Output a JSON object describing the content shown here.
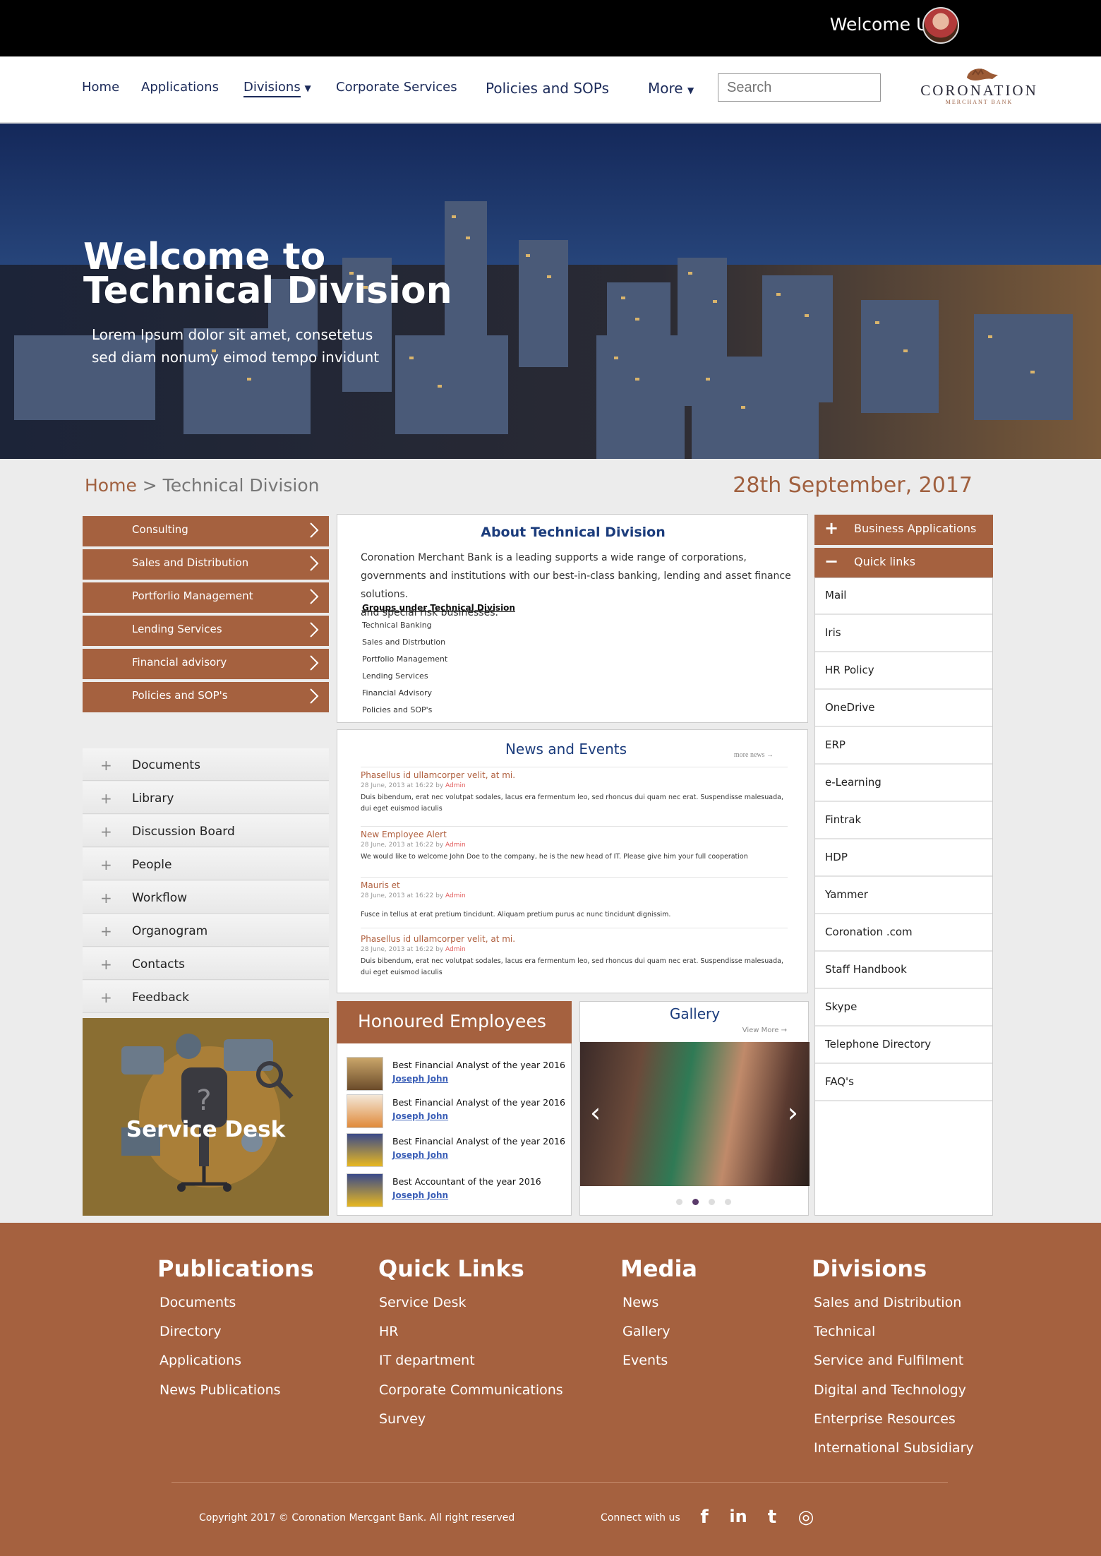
{
  "header": {
    "welcome": "Welcome User"
  },
  "nav": {
    "items": [
      "Home",
      "Applications",
      "Divisions",
      "Corporate Services",
      "Policies and SOPs",
      "More"
    ],
    "search_placeholder": "Search",
    "logo_name": "CORONATION",
    "logo_sub": "MERCHANT BANK"
  },
  "hero": {
    "title": "Welcome to Technical Division",
    "subtitle": "Lorem Ipsum dolor sit amet, consetetus sed diam nonumy eimod tempo invidunt"
  },
  "breadcrumb": {
    "home": "Home",
    "separator": " > ",
    "current": "Technical Division"
  },
  "date": "28th September, 2017",
  "left_menu": {
    "divisions": [
      "Consulting",
      "Sales and Distribution",
      "Portforlio Management",
      "Lending Services",
      "Financial advisory",
      "Policies and SOP's"
    ],
    "links": [
      "Documents",
      "Library",
      "Discussion Board",
      "People",
      "Workflow",
      "Organogram",
      "Contacts",
      "Feedback"
    ],
    "service_desk": "Service Desk"
  },
  "about": {
    "title": "About Technical Division",
    "body": "Coronation Merchant Bank is a leading supports a wide range of corporations, governments and institutions with our best-in-class banking, lending and asset finance solutions.",
    "body2": "and special risk businesses.",
    "groups_title": "Groups under Technical Division",
    "groups": [
      "Technical Banking",
      "Sales and Distrbution",
      "Portfolio Management",
      "Lending Services",
      "Financial Advisory",
      "Policies and SOP's"
    ]
  },
  "news": {
    "title": "News and Events",
    "more": "more news →",
    "items": [
      {
        "headline": "Phasellus id ullamcorper velit, at mi.",
        "date": "28 June, 2013 at 16:22 by ",
        "author": "Admin",
        "body": "Duis bibendum, erat nec volutpat sodales, lacus era fermentum leo, sed rhoncus dui quam nec erat. Suspendisse malesuada, dui eget euismod iaculis"
      },
      {
        "headline": "New Employee Alert",
        "date": "28 June, 2013 at 16:22 by ",
        "author": "Admin",
        "body": "We would like to welcome John Doe to the company, he is the new head of IT. Please give him your full cooperation"
      },
      {
        "headline": "Mauris et",
        "date": "28 June, 2013 at 16:22 by ",
        "author": "Admin",
        "body": "Fusce in tellus at erat pretium tincidunt. Aliquam pretium purus ac nunc tincidunt dignissim."
      },
      {
        "headline": "Phasellus id ullamcorper velit, at mi.",
        "date": "28 June, 2013 at 16:22 by ",
        "author": "Admin",
        "body": "Duis bibendum, erat nec volutpat sodales, lacus era fermentum leo, sed rhoncus dui quam nec erat. Suspendisse malesuada, dui eget euismod iaculis"
      }
    ]
  },
  "honoured": {
    "title": "Honoured Employees",
    "items": [
      {
        "award": "Best Financial Analyst of the year 2016",
        "name": "Joseph John"
      },
      {
        "award": "Best Financial Analyst of the year 2016",
        "name": "Joseph John"
      },
      {
        "award": "Best Financial Analyst of the year 2016",
        "name": "Joseph John"
      },
      {
        "award": "Best Accountant of the year 2016",
        "name": "Joseph John"
      }
    ]
  },
  "gallery": {
    "title": "Gallery",
    "view_more": "View More →",
    "active_slide": 2,
    "slide_count": 4
  },
  "right": {
    "business": "Business Applications",
    "quick": "Quick links",
    "links": [
      "Mail",
      "Iris",
      "HR Policy",
      "OneDrive",
      "ERP",
      "e-Learning",
      "Fintrak",
      "HDP",
      "Yammer",
      "Coronation .com",
      "Staff Handbook",
      "Skype",
      "Telephone Directory",
      "FAQ's"
    ]
  },
  "footer": {
    "publications": {
      "title": "Publications",
      "links": [
        "Documents",
        "Directory",
        "Applications",
        "News Publications"
      ]
    },
    "quick_links": {
      "title": "Quick Links",
      "links": [
        "Service Desk",
        "HR",
        "IT department",
        "Corporate Communications",
        "Survey"
      ]
    },
    "media": {
      "title": "Media",
      "links": [
        "News",
        "Gallery",
        "Events"
      ]
    },
    "divisions": {
      "title": "Divisions",
      "links": [
        "Sales and Distribution",
        "Technical",
        "Service and Fulfilment",
        "Digital and Technology",
        "Enterprise Resources",
        "International Subsidiary"
      ]
    },
    "copyright": "Copyright 2017 © Coronation Mercgant Bank. All right reserved",
    "connect": "Connect with us",
    "social": [
      {
        "name": "facebook-icon",
        "glyph": "f"
      },
      {
        "name": "linkedin-icon",
        "glyph": "in"
      },
      {
        "name": "twitter-icon",
        "glyph": "t"
      },
      {
        "name": "instagram-icon",
        "glyph": "◎"
      }
    ]
  },
  "colors": {
    "brand": "#a5613f",
    "navy": "#1b3c7c",
    "background": "#ececec"
  }
}
